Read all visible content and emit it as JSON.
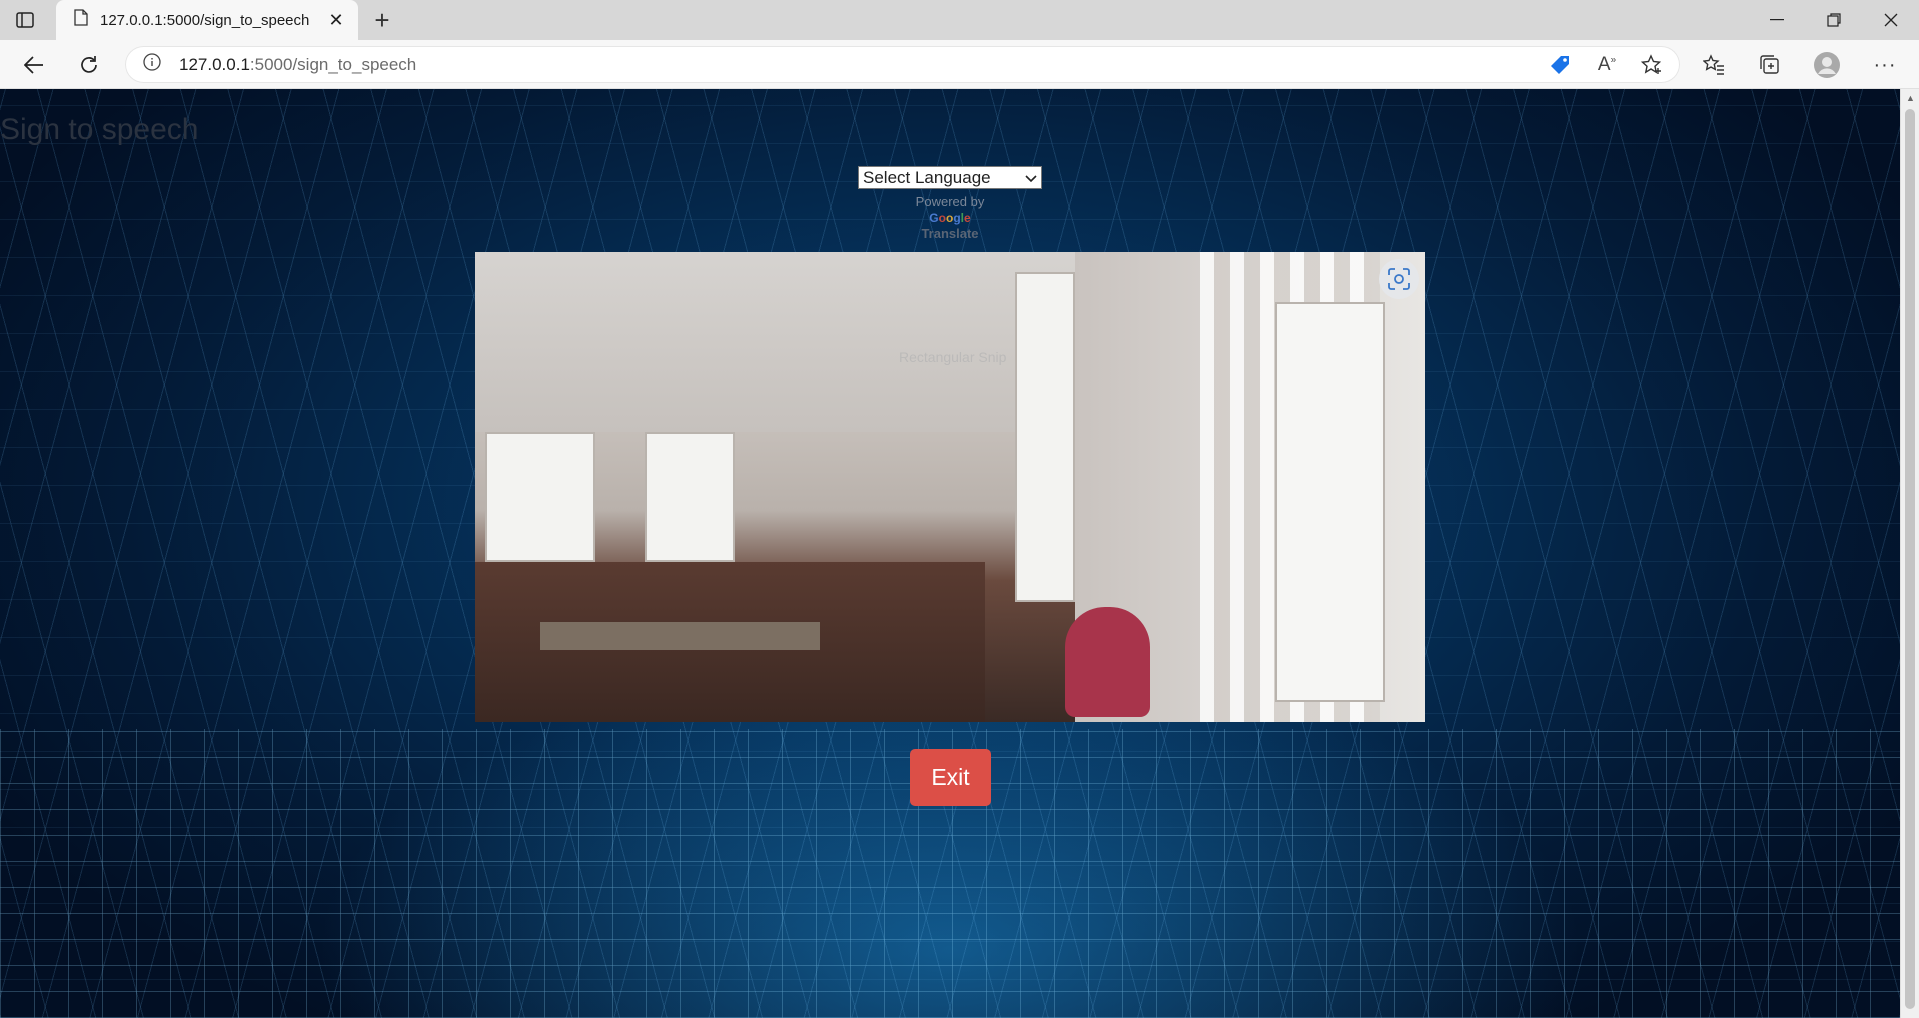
{
  "browser": {
    "tab_title": "127.0.0.1:5000/sign_to_speech",
    "url_host": "127.0.0.1",
    "url_rest": ":5000/sign_to_speech"
  },
  "page": {
    "title": "Sign to speech",
    "language_select": {
      "selected": "Select Language"
    },
    "powered_by": "Powered by",
    "google": [
      "G",
      "o",
      "o",
      "g",
      "l",
      "e"
    ],
    "translate": "Translate",
    "camera_overlay": "Rectangular Snip",
    "exit_label": "Exit"
  },
  "colors": {
    "exit_button": "#dc4f47",
    "background_dark": "#031a36",
    "background_glow": "#0a4a7a"
  }
}
